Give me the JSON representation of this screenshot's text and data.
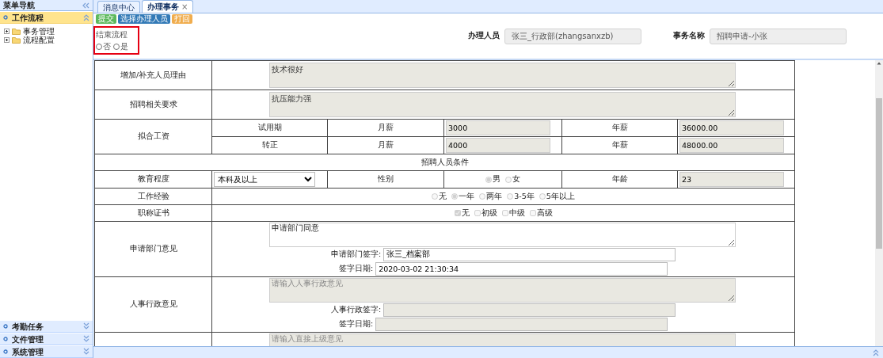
{
  "sidebar": {
    "title": "菜单导航",
    "sections": [
      {
        "label": "工作流程",
        "selected": true,
        "expanded": true,
        "children": [
          {
            "label": "事务管理"
          },
          {
            "label": "流程配置"
          }
        ]
      },
      {
        "label": "考勤任务",
        "selected": false,
        "expanded": false
      },
      {
        "label": "文件管理",
        "selected": false,
        "expanded": false
      },
      {
        "label": "系统管理",
        "selected": false,
        "expanded": false
      }
    ]
  },
  "tabs": [
    {
      "label": "消息中心",
      "selected": false
    },
    {
      "label": "办理事务",
      "selected": true,
      "close": "×"
    }
  ],
  "toolbar": [
    {
      "label": "提交",
      "kind": "success"
    },
    {
      "label": "选择办理人员",
      "kind": "primary"
    },
    {
      "label": "打回",
      "kind": "warning"
    }
  ],
  "end_flow": {
    "label": "结束流程",
    "options": [
      {
        "label": "否",
        "selected": false
      },
      {
        "label": "是",
        "selected": false
      }
    ]
  },
  "header_fields": [
    {
      "label": "办理人员",
      "value": "张三_行政部(zhangsanxzb)"
    },
    {
      "label": "事务名称",
      "value": "招聘申请-小张"
    }
  ],
  "form": {
    "rows": [
      {
        "kind": "textarea",
        "label": "增加/补充人员理由",
        "value": "技术很好",
        "disabled": true
      },
      {
        "kind": "textarea",
        "label": "招聘相关要求",
        "value": "抗压能力强",
        "disabled": true
      },
      {
        "kind": "salary",
        "label": "拟合工资",
        "lines": [
          {
            "period": "试用期",
            "monthly_label": "月薪",
            "monthly": "3000",
            "yearly_label": "年薪",
            "yearly": "36000.00"
          },
          {
            "period": "转正",
            "monthly_label": "月薪",
            "monthly": "4000",
            "yearly_label": "年薪",
            "yearly": "48000.00"
          }
        ]
      },
      {
        "kind": "heading",
        "label": "招聘人员条件"
      },
      {
        "kind": "education",
        "label": "教育程度",
        "select": "本科及以上",
        "gender_label": "性别",
        "genders": [
          {
            "label": "男",
            "selected": true
          },
          {
            "label": "女",
            "selected": false
          }
        ],
        "age_label": "年龄",
        "age": "23"
      },
      {
        "kind": "radios",
        "label": "工作经验",
        "options": [
          {
            "label": "无",
            "selected": false
          },
          {
            "label": "一年",
            "selected": true
          },
          {
            "label": "两年",
            "selected": false
          },
          {
            "label": "3-5年",
            "selected": false
          },
          {
            "label": "5年以上",
            "selected": false
          }
        ]
      },
      {
        "kind": "checkboxes",
        "label": "职称证书",
        "options": [
          {
            "label": "无",
            "checked": true
          },
          {
            "label": "初级",
            "checked": false
          },
          {
            "label": "中级",
            "checked": false
          },
          {
            "label": "高级",
            "checked": false
          }
        ]
      },
      {
        "kind": "opinion",
        "label": "申请部门意见",
        "disabled": false,
        "value": "申请部门同意",
        "sign_label": "申请部门签字:",
        "sign": "张三_档案部",
        "date_label": "签字日期:",
        "date": "2020-03-02 21:30:34"
      },
      {
        "kind": "opinion",
        "label": "人事行政意见",
        "disabled": true,
        "placeholder": "请输入人事行政意见",
        "sign_label": "人事行政签字:",
        "date_label": "签字日期:"
      },
      {
        "kind": "opinion",
        "disabled": true,
        "placeholder": "请输入直接上级意见"
      }
    ]
  }
}
